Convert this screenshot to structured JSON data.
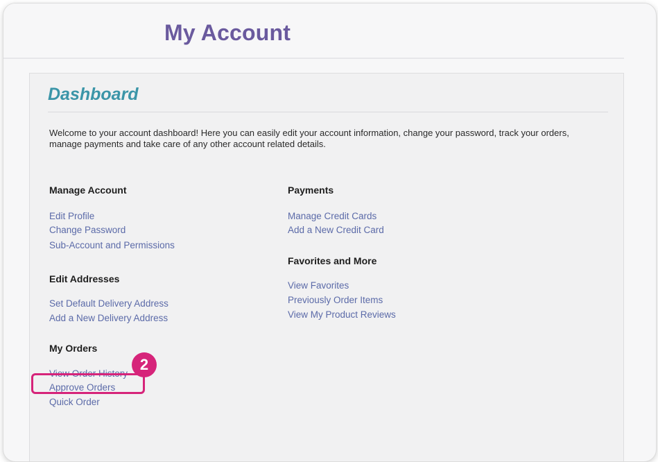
{
  "header": {
    "title": "My Account"
  },
  "dashboard": {
    "title": "Dashboard",
    "welcome_text": "Welcome to your account dashboard! Here you can easily edit your account information, change your password, track your orders, manage payments and take care of any other account related details."
  },
  "sections": {
    "manage_account": {
      "heading": "Manage Account",
      "links": [
        "Edit Profile",
        "Change Password",
        "Sub-Account and Permissions"
      ]
    },
    "edit_addresses": {
      "heading": "Edit Addresses",
      "links": [
        "Set Default Delivery Address",
        "Add a New Delivery Address"
      ]
    },
    "my_orders": {
      "heading": "My Orders",
      "links": [
        "View Order History",
        "Approve Orders",
        "Quick Order"
      ]
    },
    "payments": {
      "heading": "Payments",
      "links": [
        "Manage Credit Cards",
        "Add a New Credit Card"
      ]
    },
    "favorites": {
      "heading": "Favorites and More",
      "links": [
        "View Favorites",
        "Previously Order Items",
        "View My Product Reviews"
      ]
    }
  },
  "annotation": {
    "step_number": "2"
  },
  "colors": {
    "title": "#6a5a9e",
    "dashboard_title": "#3b95a8",
    "link": "#5b6aa8",
    "highlight": "#d6247a"
  }
}
